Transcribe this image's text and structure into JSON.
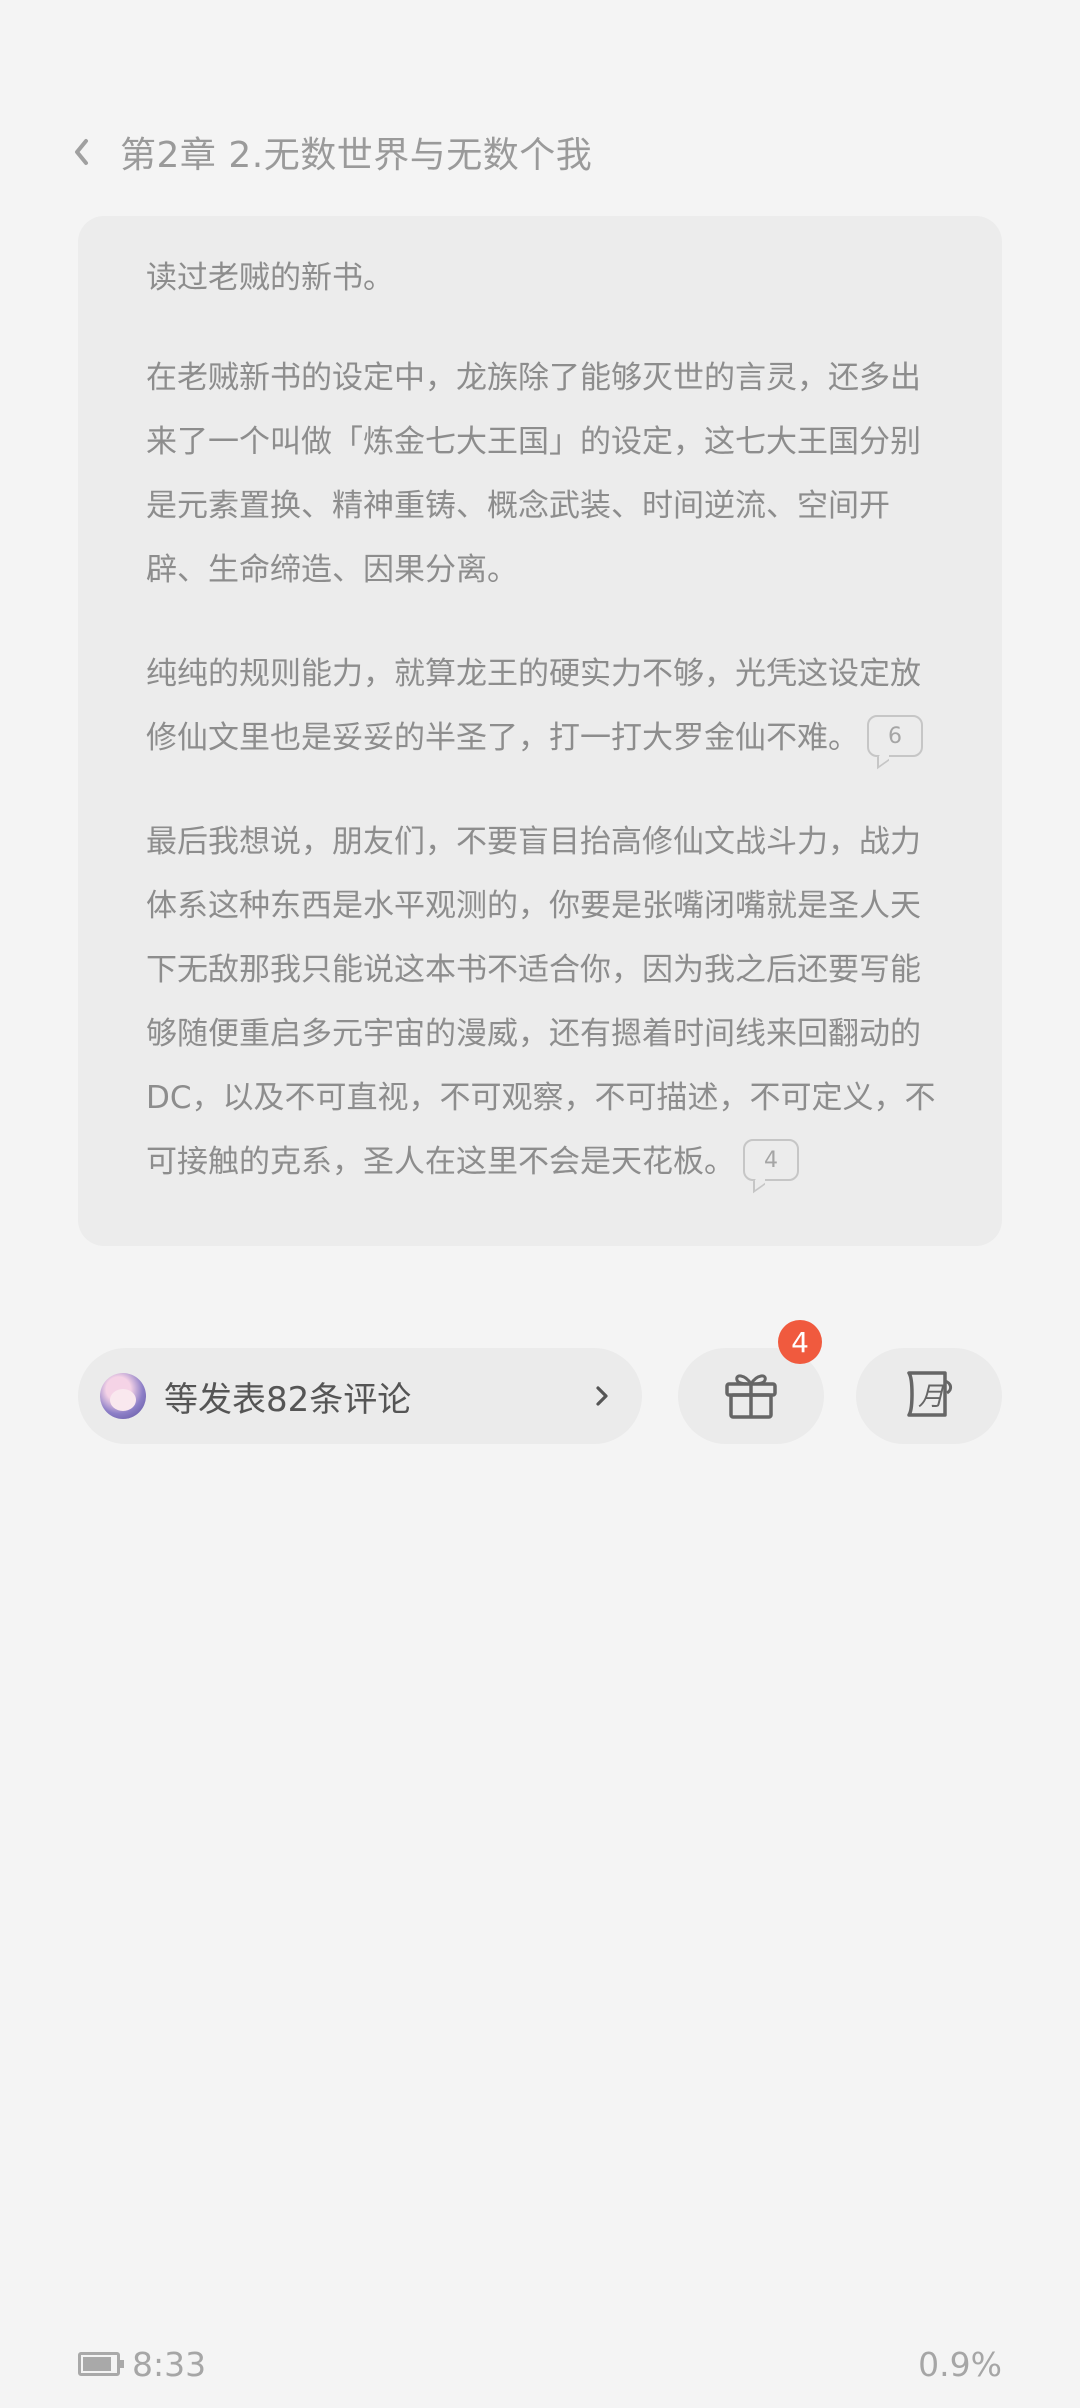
{
  "header": {
    "chapter_title": "第2章 2.无数世界与无数个我"
  },
  "content": {
    "paragraphs": [
      {
        "text": "读过老贼的新书。"
      },
      {
        "text": "在老贼新书的设定中，龙族除了能够灭世的言灵，还多出来了一个叫做「炼金七大王国」的设定，这七大王国分别是元素置换、精神重铸、概念武装、时间逆流、空间开辟、生命缔造、因果分离。"
      },
      {
        "text": "纯纯的规则能力，就算龙王的硬实力不够，光凭这设定放修仙文里也是妥妥的半圣了，打一打大罗金仙不难。",
        "comment_count": "6"
      },
      {
        "text": "最后我想说，朋友们，不要盲目抬高修仙文战斗力，战力体系这种东西是水平观测的，你要是张嘴闭嘴就是圣人天下无敌那我只能说这本书不适合你，因为我之后还要写能够随便重启多元宇宙的漫威，还有摁着时间线来回翻动的DC，以及不可直视，不可观察，不可描述，不可定义，不可接触的克系，圣人在这里不会是天花板。",
        "comment_count": "4"
      }
    ]
  },
  "actions": {
    "comments_label": "等发表82条评论",
    "gift_badge_count": "4"
  },
  "footer": {
    "time": "8:33",
    "progress": "0.9%"
  },
  "icons": {
    "back": "chevron-left-icon",
    "comments_chevron": "chevron-right-icon",
    "gift": "gift-icon",
    "monthly_ticket": "monthly-ticket-icon",
    "battery": "battery-icon"
  },
  "colors": {
    "background": "#f4f4f4",
    "card": "#ececec",
    "badge": "#f05a3e",
    "text": "#8d8d8d"
  }
}
